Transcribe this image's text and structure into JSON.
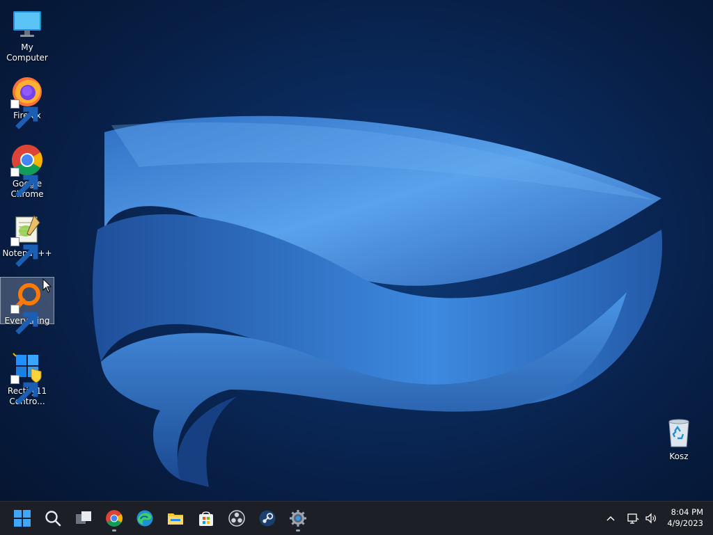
{
  "desktop": {
    "icons": [
      {
        "label": "My Computer"
      },
      {
        "label": "Firefox"
      },
      {
        "label": "Google Chrome"
      },
      {
        "label": "Notepad++"
      },
      {
        "label": "Everything"
      },
      {
        "label": "Rectify11 Contro..."
      }
    ],
    "recycle_bin": {
      "label": "Kosz"
    },
    "selected_icon": "Everything"
  },
  "taskbar": {
    "apps": [
      "start-icon",
      "search-icon",
      "task-view-icon",
      "chrome-icon",
      "edge-icon",
      "file-explorer-icon",
      "store-icon",
      "obs-icon",
      "steam-icon",
      "settings-icon"
    ],
    "running": [
      "chrome-icon",
      "settings-icon"
    ]
  },
  "tray": {
    "time": "8:04 PM",
    "date": "4/9/2023",
    "icons": [
      "show-hidden-icons-chevron",
      "network-icon",
      "volume-icon"
    ]
  },
  "colors": {
    "wallpaper_bg": "#071c40",
    "bloom_blue": "#3a86d8",
    "taskbar_bg": "#1c1f26",
    "selection": "#c8d2e1"
  }
}
